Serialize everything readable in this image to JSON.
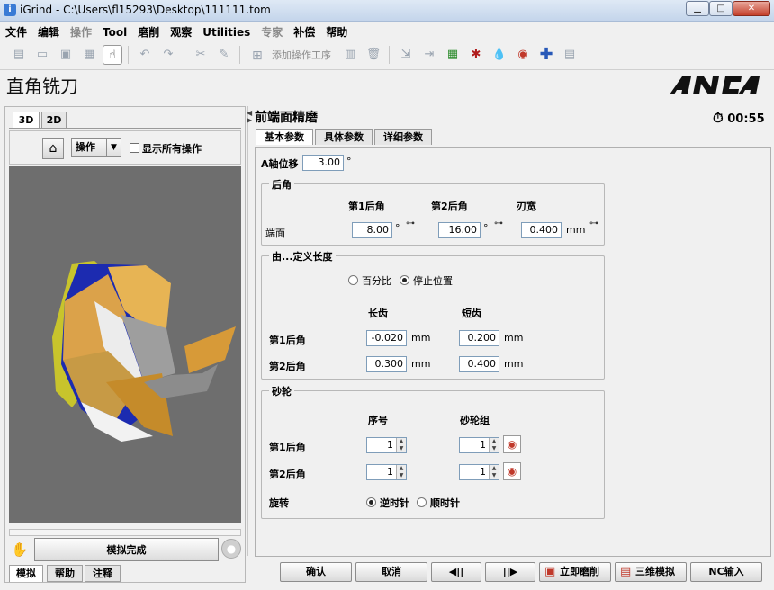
{
  "window": {
    "title": "iGrind - C:\\Users\\fl15293\\Desktop\\111111.tom",
    "min": "▁",
    "max": "□",
    "close": "✕"
  },
  "menu": [
    "文件",
    "编辑",
    "操作",
    "Tool",
    "磨削",
    "观察",
    "Utilities",
    "专家",
    "补偿",
    "帮助"
  ],
  "menu_disabled": [
    false,
    false,
    true,
    false,
    false,
    false,
    false,
    true,
    false,
    false
  ],
  "toolbar": {
    "add_operation_label": "添加操作工序"
  },
  "header": {
    "page_title": "直角铣刀",
    "logo": "ANCA"
  },
  "left": {
    "tabs": [
      "3D",
      "2D"
    ],
    "op_dropdown": "操作",
    "show_all_ops": "显示所有操作",
    "sim_done": "模拟完成",
    "bottom_tabs": [
      "模拟",
      "帮助",
      "注释"
    ]
  },
  "right": {
    "op_title": "前端面精磨",
    "timer": "00:55",
    "tabs": [
      "基本参数",
      "具体参数",
      "详细参数"
    ],
    "a_axis_label": "A轴位移",
    "a_axis_value": "3.00",
    "deg": "°",
    "relief": {
      "title": "后角",
      "col1": "第1后角",
      "col2": "第2后角",
      "col3": "刃宽",
      "row_label": "端面",
      "v1": "8.00",
      "v2": "16.00",
      "v3": "0.400",
      "unit": "mm"
    },
    "length": {
      "title": "由...定义长度",
      "opt_percent": "百分比",
      "opt_stop": "停止位置",
      "col_long": "长齿",
      "col_short": "短齿",
      "row1": "第1后角",
      "row2": "第2后角",
      "r1_long": "-0.020",
      "r1_short": "0.200",
      "r2_long": "0.300",
      "r2_short": "0.400",
      "unit": "mm"
    },
    "wheel": {
      "title": "砂轮",
      "col_no": "序号",
      "col_set": "砂轮组",
      "row1": "第1后角",
      "row2": "第2后角",
      "r1_no": "1",
      "r1_set": "1",
      "r2_no": "1",
      "r2_set": "1",
      "rotation": "旋转",
      "ccw": "逆时针",
      "cw": "顺时针"
    }
  },
  "buttons": {
    "ok": "确认",
    "cancel": "取消",
    "prev": "◀||",
    "next": "||▶",
    "grind_now": "立即磨削",
    "sim3d": "三维模拟",
    "nc_input": "NC输入"
  }
}
